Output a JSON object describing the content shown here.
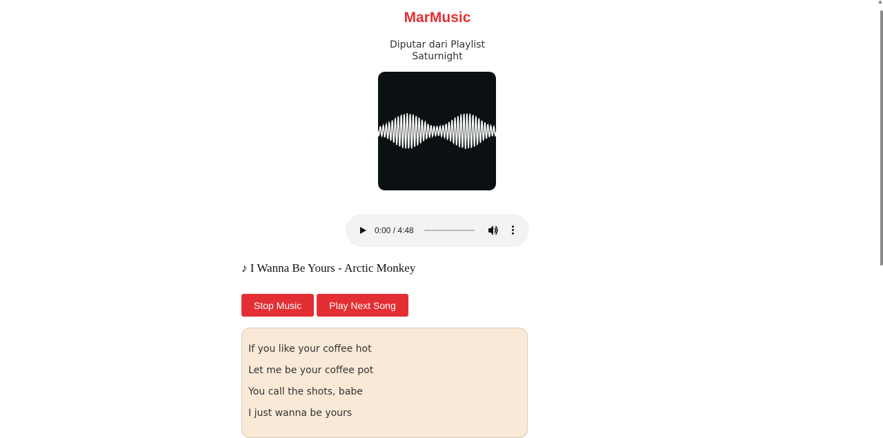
{
  "app": {
    "title": "MarMusic"
  },
  "now_playing": {
    "subtitle_line1": "Diputar dari Playlist",
    "subtitle_line2": "Saturnight",
    "cover_icon": "soundwave-artwork",
    "song_title": "♪ I Wanna Be Yours - Arctic Monkey"
  },
  "player": {
    "time_display": "0:00 / 4:48",
    "progress": 0,
    "play_icon": "play-icon",
    "volume_icon": "volume-icon",
    "more_icon": "more-vertical-icon"
  },
  "controls": {
    "stop_label": "Stop Music",
    "next_label": "Play Next Song"
  },
  "lyrics": {
    "lines": [
      "If you like your coffee hot",
      "Let me be your coffee pot",
      "You call the shots, babe",
      "I just wanna be yours"
    ]
  },
  "colors": {
    "accent": "#e32f34",
    "lyrics_bg": "#f9e9d6",
    "cover_bg": "#0b1112",
    "player_bg": "#f1f3f4"
  }
}
